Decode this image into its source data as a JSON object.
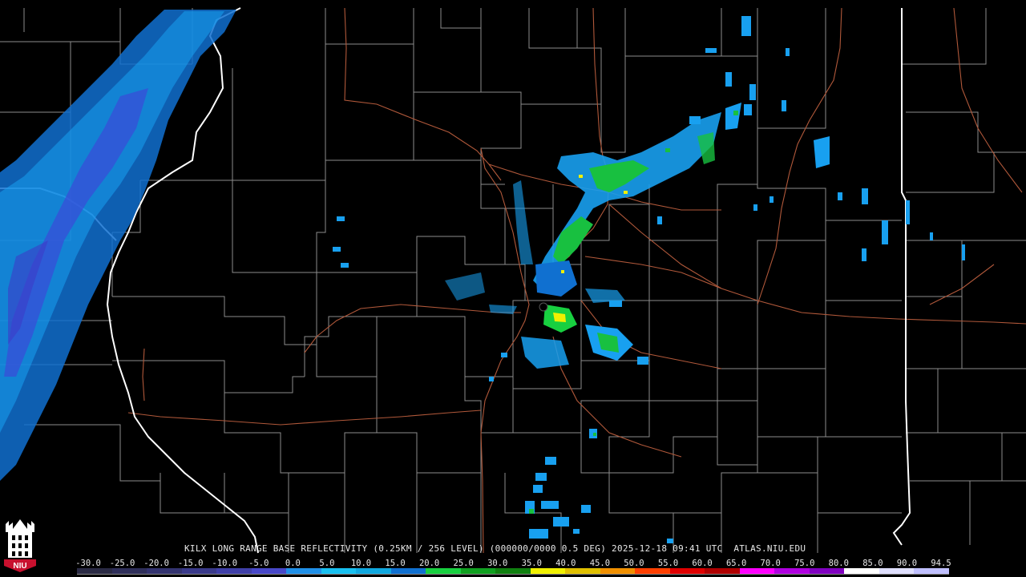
{
  "product_title": "KILX LONG RANGE BASE REFLECTIVITY (0.25KM / 256 LEVEL) (000000/0000 0.5 DEG) 2025-12-18 09:41 UTC  ATLAS.NIU.EDU",
  "logo_text": "NIU",
  "colors": {
    "background": "#000000",
    "county_lines": "#8c8c8c",
    "state_lines": "#ffffff",
    "roads": "#b0583a",
    "logo_red": "#c8102e"
  },
  "scale": {
    "ticks": [
      "-30.0",
      "-25.0",
      "-20.0",
      "-15.0",
      "-10.0",
      "-5.0",
      "0.0",
      "5.0",
      "10.0",
      "15.0",
      "20.0",
      "25.0",
      "30.0",
      "35.0",
      "40.0",
      "45.0",
      "50.0",
      "55.0",
      "60.0",
      "65.0",
      "70.0",
      "75.0",
      "80.0",
      "85.0",
      "90.0",
      "94.5"
    ],
    "colors": [
      "#2a2a44",
      "#2f2f5a",
      "#343470",
      "#3a3a8a",
      "#4040a8",
      "#4848c8",
      "#2090e8",
      "#18c0f0",
      "#10a8e0",
      "#1070d0",
      "#18d040",
      "#10a020",
      "#108010",
      "#f0f000",
      "#e0c000",
      "#f09000",
      "#ff4000",
      "#e00000",
      "#b00000",
      "#ff00ff",
      "#b000e0",
      "#8000c0",
      "#ffffff",
      "#e0e0ff",
      "#c0c0ff"
    ]
  }
}
